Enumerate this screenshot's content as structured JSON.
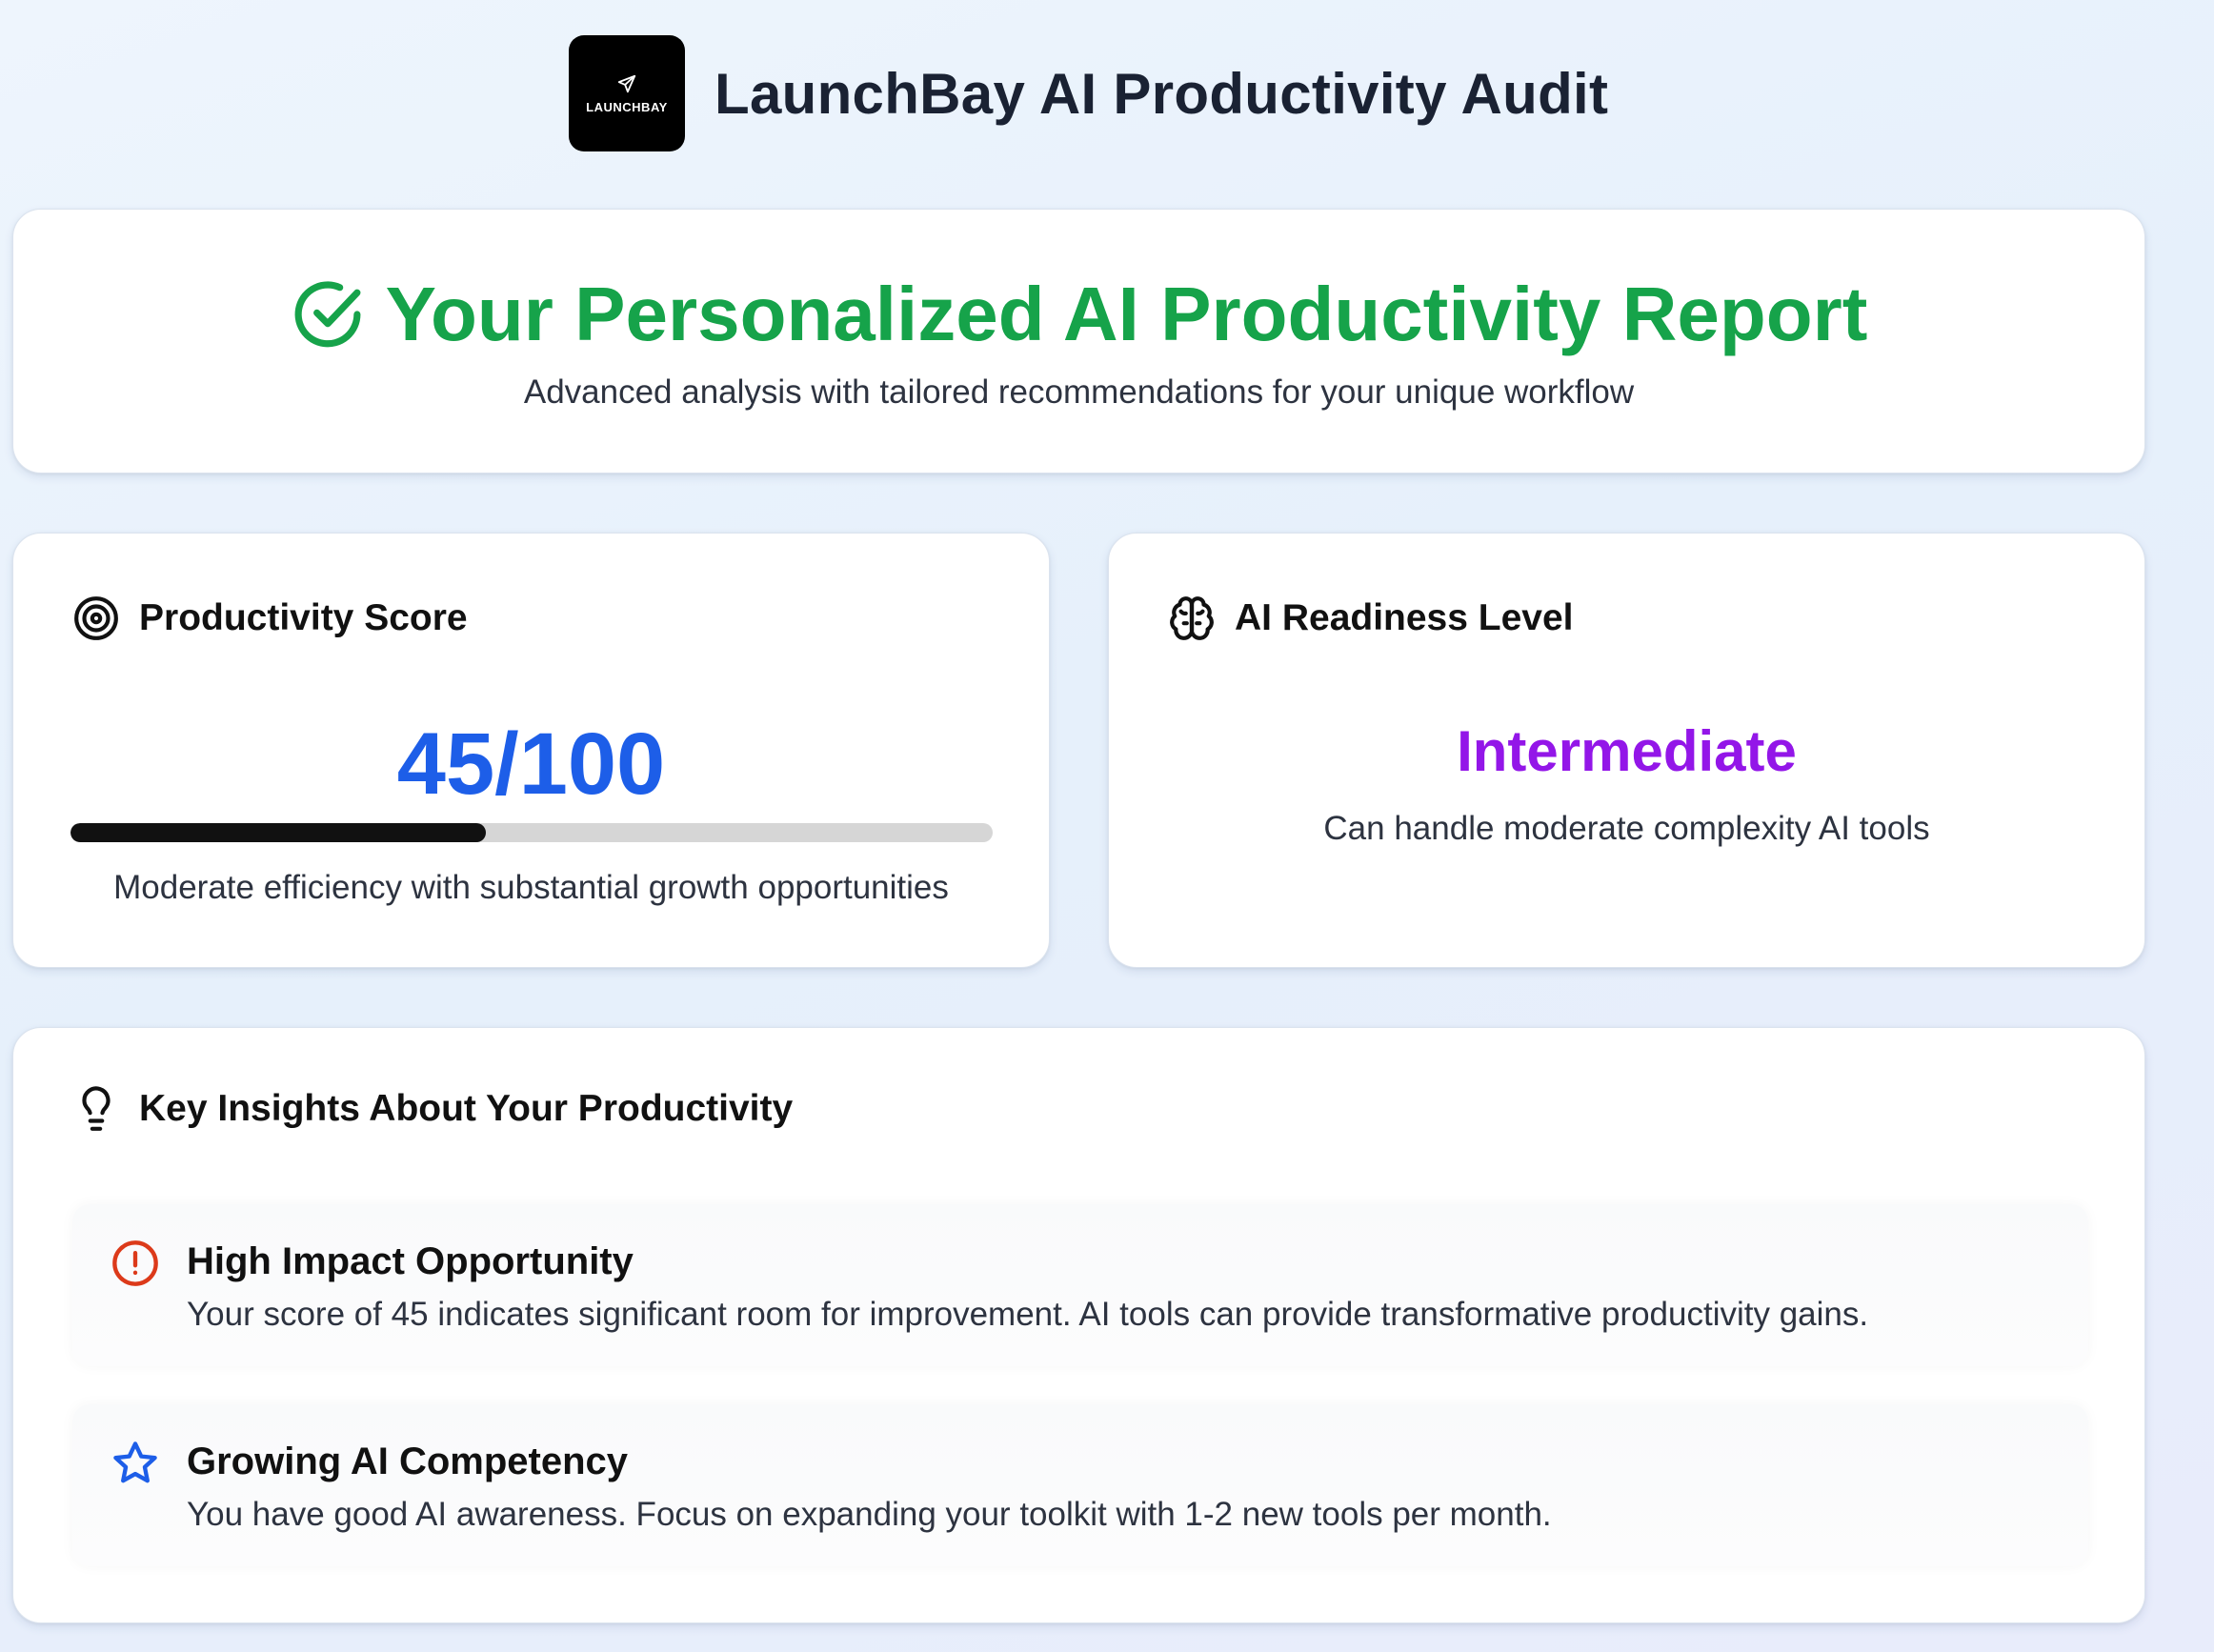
{
  "header": {
    "logo_text": "LAUNCHBAY",
    "title": "LaunchBay AI Productivity Audit"
  },
  "report": {
    "title": "Your Personalized AI Productivity Report",
    "subtitle": "Advanced analysis with tailored recommendations for your unique workflow",
    "icon": "check-circle-icon",
    "accent_color": "#16a34a"
  },
  "score_card": {
    "heading": "Productivity Score",
    "icon": "target-icon",
    "score_text": "45/100",
    "score_value": 45,
    "score_max": 100,
    "progress_fraction": 0.45,
    "description": "Moderate efficiency with substantial growth opportunities",
    "accent_color": "#1d5ee8"
  },
  "readiness_card": {
    "heading": "AI Readiness Level",
    "icon": "brain-icon",
    "level": "Intermediate",
    "description": "Can handle moderate complexity AI tools",
    "accent_color": "#9316e8"
  },
  "insights": {
    "heading": "Key Insights About Your Productivity",
    "icon": "lightbulb-icon",
    "items": [
      {
        "icon": "alert-circle-icon",
        "icon_color": "#dc3a1a",
        "title": "High Impact Opportunity",
        "text": "Your score of 45 indicates significant room for improvement. AI tools can provide transformative productivity gains."
      },
      {
        "icon": "star-icon",
        "icon_color": "#1d5ee8",
        "title": "Growing AI Competency",
        "text": "You have good AI awareness. Focus on expanding your toolkit with 1-2 new tools per month."
      }
    ]
  }
}
